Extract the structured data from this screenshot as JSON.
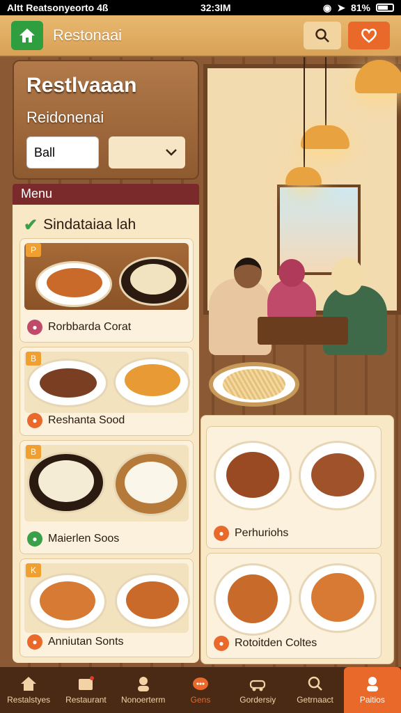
{
  "status_bar": {
    "left_text": "Altt Reatsonyeorto 4ß",
    "time": "32:3IM",
    "battery": "81%"
  },
  "header": {
    "title": "Restonaai"
  },
  "restaurant_panel": {
    "title": "Restlvaaan",
    "subtitle": "Reidonenai",
    "input_value": "Ball"
  },
  "menu": {
    "bar_label": "Menu",
    "section_title": "Sindataiaa lah",
    "cards": [
      {
        "num": "P",
        "label": "Rorbbarda Corat"
      },
      {
        "num": "B",
        "label": "Reshanta Sood"
      },
      {
        "num": "B",
        "label": "Maierlen Soos"
      },
      {
        "num": "K",
        "label": "Anniutan Sonts"
      }
    ]
  },
  "right_cards": [
    {
      "label": "Perhuriohs"
    },
    {
      "label": "Rotoitden Coltes"
    }
  ],
  "bottom_nav": [
    {
      "label": "Restalstyes",
      "icon": "home-icon"
    },
    {
      "label": "Restaurant",
      "icon": "store-icon"
    },
    {
      "label": "Nonoerterm",
      "icon": "person-icon"
    },
    {
      "label": "Gens",
      "icon": "chat-icon"
    },
    {
      "label": "Gordersiy",
      "icon": "vehicle-icon"
    },
    {
      "label": "Getrnaact",
      "icon": "search-icon"
    },
    {
      "label": "Paitios",
      "icon": "profile-icon"
    }
  ],
  "colors": {
    "accent": "#e8692a",
    "header": "#d9a256",
    "menu_bar": "#7a2a2a",
    "active_green": "#3aa14a"
  }
}
